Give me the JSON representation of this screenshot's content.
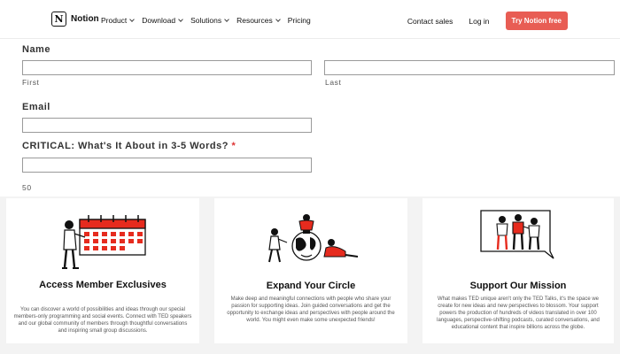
{
  "nav": {
    "logo_text": "Notion",
    "logo_glyph": "N",
    "links": [
      "Product",
      "Download",
      "Solutions",
      "Resources"
    ],
    "pricing": "Pricing",
    "contact": "Contact sales",
    "login": "Log in",
    "cta": "Try Notion free",
    "cta_color": "#e85d54"
  },
  "form": {
    "name_label": "Name",
    "first_sub": "First",
    "last_sub": "Last",
    "email_label": "Email",
    "critical_label": "CRITICAL: What's It About in 3-5 Words?",
    "required_mark": "*",
    "char_counter": "50"
  },
  "cards": [
    {
      "title": "Access Member Exclusives",
      "body": "You can discover a world of possibilities and ideas through our special members-only programming and social events. Connect with TED speakers and our global community of members through thoughtful conversations and inspiring small group discussions.",
      "icon": "calendar-illustration"
    },
    {
      "title": "Expand Your Circle",
      "body": "Make deep and meaningful connections with people who share your passion for supporting ideas. Join guided conversations and get the opportunity to exchange ideas and perspectives with people around the world. You might even make some unexpected friends!",
      "icon": "globe-people-illustration"
    },
    {
      "title": "Support Our Mission",
      "body": "What makes TED unique aren't only the TED Talks, it's the space we create for new ideas and new perspectives to blossom. Your support powers the production of hundreds of videos translated in over 100 languages, perspective-shifting podcasts, curated conversations, and educational content that inspire billions across the globe.",
      "icon": "speech-bubble-illustration"
    }
  ],
  "colors": {
    "accent": "#e62b1e"
  }
}
